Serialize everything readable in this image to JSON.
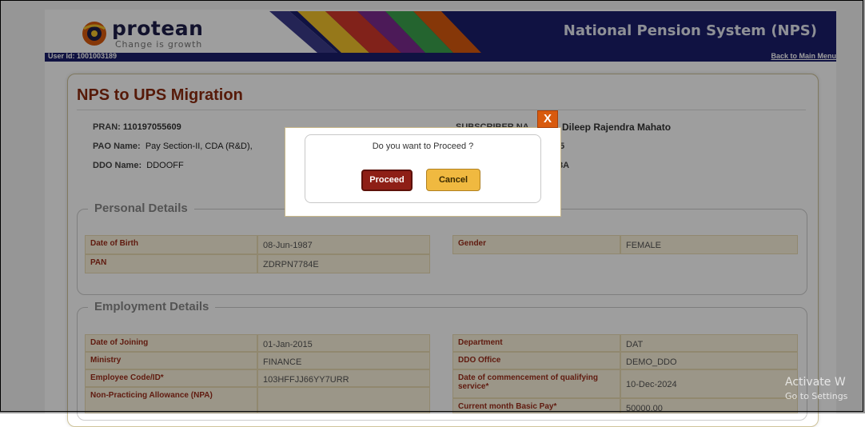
{
  "header": {
    "logo_text": "protean",
    "logo_tagline": "Change is growth",
    "system_title": "National Pension System (NPS)",
    "user_id": "User Id: 1001003189",
    "back_link": "Back to Main Menu",
    "colors": {
      "navy": "#1b1e6b",
      "brand_orange": "#d85a0e"
    }
  },
  "page": {
    "title": "NPS to UPS Migration"
  },
  "subscriber_info": {
    "pran_label": "PRAN:",
    "pran_value": "110197055609",
    "subscriber_label": "SUBSCRIBER NA",
    "subscriber_value": "Dileep Rajendra Mahato",
    "pao_label": "PAO Name:",
    "pao_value": "Pay Section-II, CDA (R&D),",
    "pao_right_partial": "5",
    "ddo_label": "DDO Name:",
    "ddo_value": "DDOOFF",
    "ddo_right_partial": "8A"
  },
  "personal_details": {
    "legend": "Personal Details",
    "rows": [
      {
        "label": "Date of Birth",
        "value": "08-Jun-1987",
        "label2": "Gender",
        "value2": "FEMALE"
      },
      {
        "label": "PAN",
        "value": "ZDRPN7784E"
      }
    ]
  },
  "employment_details": {
    "legend": "Employment Details",
    "rows": [
      {
        "label": "Date of Joining",
        "value": "01-Jan-2015",
        "label2": "Department",
        "value2": "DAT"
      },
      {
        "label": "Ministry",
        "value": "FINANCE",
        "label2": "DDO Office",
        "value2": "DEMO_DDO"
      },
      {
        "label": "Employee Code/ID*",
        "value": "103HFFJJ66YY7URR",
        "label2": "Date of commencement of qualifying service*",
        "value2": "10-Dec-2024"
      },
      {
        "label": "Non-Practicing Allowance (NPA)",
        "value": "",
        "label2": "Current month Basic Pay*",
        "value2": "50000.00"
      }
    ]
  },
  "dialog": {
    "message": "Do you want to Proceed ?",
    "proceed_label": "Proceed",
    "cancel_label": "Cancel",
    "close_label": "X"
  },
  "watermark": {
    "line1": "Activate W",
    "line2": "Go to Settings"
  }
}
